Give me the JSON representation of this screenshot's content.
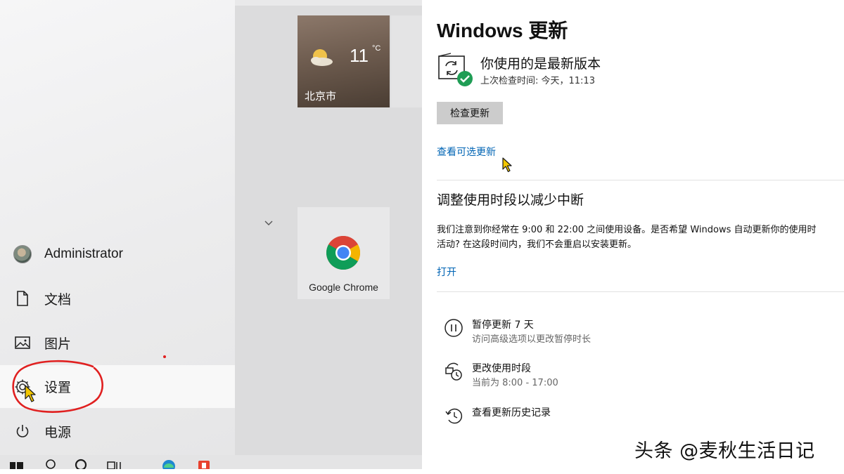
{
  "start_menu": {
    "user": {
      "name": "Administrator"
    },
    "items": {
      "documents": "文档",
      "pictures": "图片",
      "settings": "设置",
      "power": "电源"
    },
    "tiles": {
      "weather": {
        "temperature": "11",
        "unit": "°C",
        "city": "北京市"
      },
      "chrome": {
        "label": "Google Chrome"
      }
    },
    "annotation_color": "#e02020"
  },
  "settings_page": {
    "title": "Windows 更新",
    "status": "你使用的是最新版本",
    "last_check": "上次检查时间: 今天，11:13",
    "check_button": "检查更新",
    "optional_link": "查看可选更新",
    "active_hours": {
      "title": "调整使用时段以减少中断",
      "body_line1": "我们注意到你经常在 9:00 和 22:00 之间使用设备。是否希望 Windows 自动更新你的使用时",
      "body_line2": "活动? 在这段时间内，我们不会重启以安装更新。",
      "open_link": "打开"
    },
    "options": [
      {
        "title": "暂停更新 7 天",
        "subtitle": "访问高级选项以更改暂停时长",
        "icon": "pause-icon"
      },
      {
        "title": "更改使用时段",
        "subtitle": "当前为 8:00 - 17:00",
        "icon": "clock-icon"
      },
      {
        "title": "查看更新历史记录",
        "subtitle": "",
        "icon": "history-icon"
      }
    ],
    "link_color": "#0064b4",
    "success_color": "#1f9d55"
  },
  "watermark": "头条 @麦秋生活日记"
}
